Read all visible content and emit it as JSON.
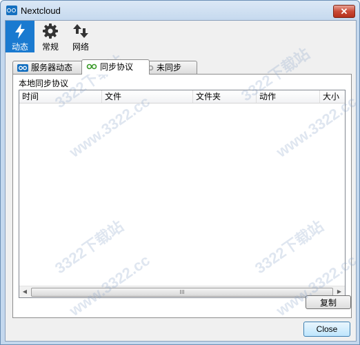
{
  "window": {
    "title": "Nextcloud",
    "close_glyph": "✕"
  },
  "toolbar": {
    "items": [
      {
        "label": "动态",
        "icon": "lightning-icon",
        "active": true
      },
      {
        "label": "常规",
        "icon": "gear-icon",
        "active": false
      },
      {
        "label": "网络",
        "icon": "network-arrows-icon",
        "active": false
      }
    ]
  },
  "tabs": [
    {
      "label": "服务器动态",
      "icon": "nextcloud-icon",
      "active": false
    },
    {
      "label": "同步协议",
      "icon": "sync-protocol-icon",
      "active": true
    },
    {
      "label": "未同步",
      "icon": "not-synced-icon",
      "active": false
    }
  ],
  "panel": {
    "group_label": "本地同步协议",
    "columns": [
      "时间",
      "文件",
      "文件夹",
      "动作",
      "大小"
    ],
    "rows": [],
    "scrollbar": {
      "left_arrow": "◀",
      "right_arrow": "▶",
      "grip": "III"
    },
    "copy_button": "复制"
  },
  "footer": {
    "close_button": "Close"
  },
  "watermarks": [
    "3322下载站",
    "www.3322.cc"
  ],
  "colors": {
    "accent": "#1a7ad0",
    "title_close": "#c94a37"
  }
}
